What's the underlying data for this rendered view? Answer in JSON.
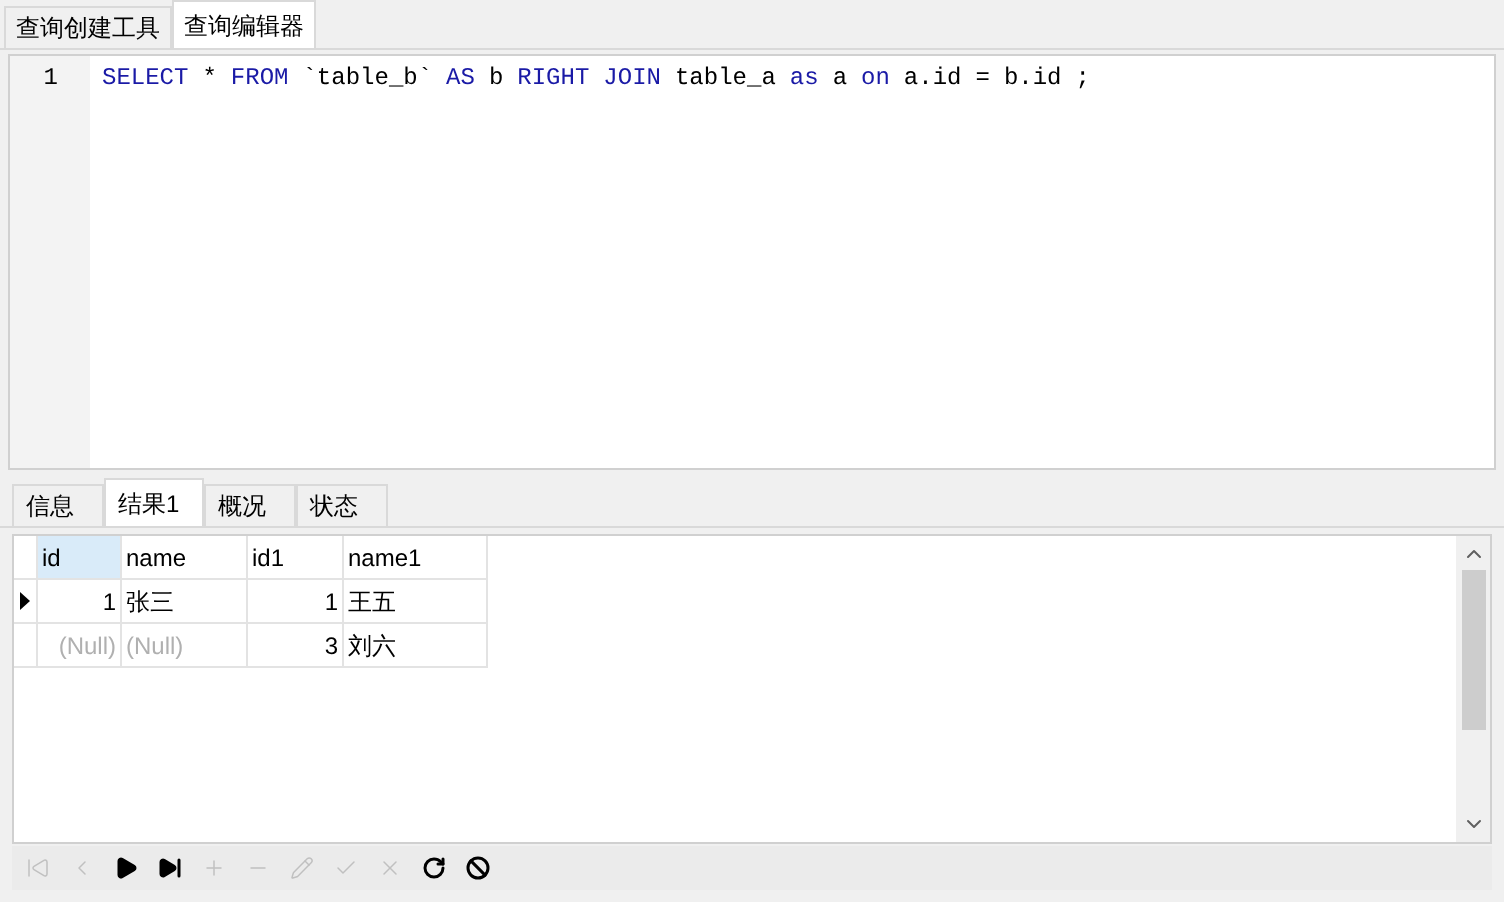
{
  "editor_tabs": [
    {
      "label": "查询创建工具",
      "selected": false
    },
    {
      "label": "查询编辑器",
      "selected": true
    }
  ],
  "editor": {
    "lines": [
      {
        "number": "1",
        "tokens": [
          {
            "text": "SELECT",
            "kind": "keyword"
          },
          {
            "text": "*",
            "kind": "plain"
          },
          {
            "text": "FROM",
            "kind": "keyword"
          },
          {
            "text": "`table_b`",
            "kind": "plain"
          },
          {
            "text": "AS",
            "kind": "keyword"
          },
          {
            "text": "b",
            "kind": "plain"
          },
          {
            "text": "RIGHT",
            "kind": "keyword"
          },
          {
            "text": "JOIN",
            "kind": "keyword"
          },
          {
            "text": "table_a",
            "kind": "plain"
          },
          {
            "text": "as",
            "kind": "keyword"
          },
          {
            "text": "a",
            "kind": "plain"
          },
          {
            "text": "on",
            "kind": "keyword"
          },
          {
            "text": "a.id",
            "kind": "plain"
          },
          {
            "text": "=",
            "kind": "plain"
          },
          {
            "text": "b.id",
            "kind": "plain"
          },
          {
            "text": ";",
            "kind": "plain"
          }
        ]
      }
    ]
  },
  "result_tabs": [
    {
      "label": "信息",
      "selected": false
    },
    {
      "label": "结果1",
      "selected": true
    },
    {
      "label": "概况",
      "selected": false
    },
    {
      "label": "状态",
      "selected": false
    }
  ],
  "table": {
    "columns": [
      {
        "label": "id",
        "selected": true,
        "kind": "number"
      },
      {
        "label": "name",
        "selected": false,
        "kind": "text"
      },
      {
        "label": "id1",
        "selected": false,
        "kind": "number"
      },
      {
        "label": "name1",
        "selected": false,
        "kind": "text"
      }
    ],
    "rows": [
      {
        "current": true,
        "cells": [
          {
            "text": "1",
            "null": false
          },
          {
            "text": "张三",
            "null": false
          },
          {
            "text": "1",
            "null": false
          },
          {
            "text": "王五",
            "null": false
          }
        ]
      },
      {
        "current": false,
        "cells": [
          {
            "text": "(Null)",
            "null": true
          },
          {
            "text": "(Null)",
            "null": true
          },
          {
            "text": "3",
            "null": false
          },
          {
            "text": "刘六",
            "null": false
          }
        ]
      }
    ]
  },
  "toolbar": [
    {
      "kind": "first",
      "disabled": true
    },
    {
      "kind": "prev",
      "disabled": true
    },
    {
      "kind": "next",
      "disabled": false
    },
    {
      "kind": "last",
      "disabled": false
    },
    {
      "kind": "add",
      "disabled": true
    },
    {
      "kind": "delete",
      "disabled": true
    },
    {
      "kind": "edit",
      "disabled": true
    },
    {
      "kind": "apply",
      "disabled": true
    },
    {
      "kind": "cancel",
      "disabled": true
    },
    {
      "kind": "refresh",
      "disabled": false
    },
    {
      "kind": "stop",
      "disabled": false
    }
  ]
}
